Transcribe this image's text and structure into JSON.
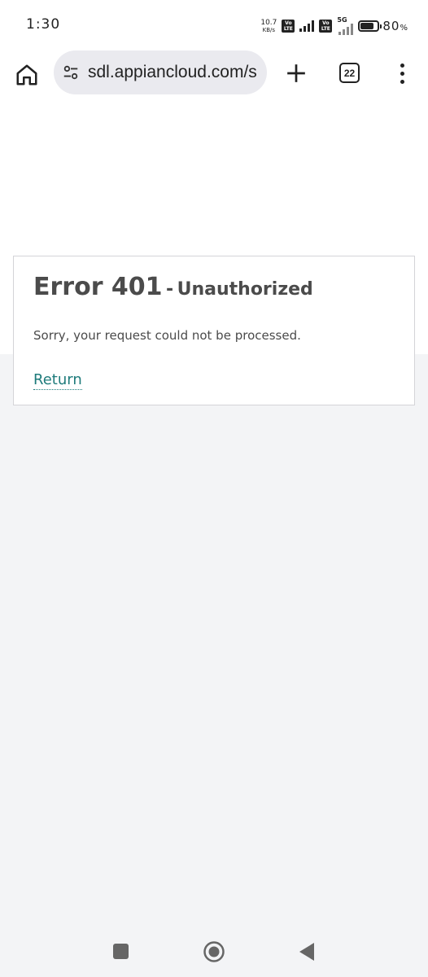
{
  "status_bar": {
    "time": "1:30",
    "net_speed_value": "10.7",
    "net_speed_unit": "KB/s",
    "sim1_badge_top": "Vo",
    "sim1_badge_bottom": "LTE",
    "sim2_badge_top": "Vo",
    "sim2_badge_bottom": "LTE",
    "network_type": "5G",
    "battery_percent": "80",
    "battery_percent_sign": "%",
    "battery_level": 0.8
  },
  "browser": {
    "url": "sdl.appiancloud.com/s",
    "tab_count": "22",
    "icons": {
      "home": "home-icon",
      "site_settings": "tune-icon",
      "new_tab": "plus-icon",
      "tabs": "tab-switcher-icon",
      "menu": "more-vert-icon"
    }
  },
  "error": {
    "code": "Error 401",
    "separator": "-",
    "title": "Unauthorized",
    "message": "Sorry, your request could not be processed.",
    "return_label": "Return"
  },
  "colors": {
    "link": "#1e7b7b",
    "heading": "#4b4b4b",
    "page_background": "#f3f4f6"
  },
  "nav_bar": {
    "icons": [
      "recents-icon",
      "home-icon",
      "back-icon"
    ]
  }
}
